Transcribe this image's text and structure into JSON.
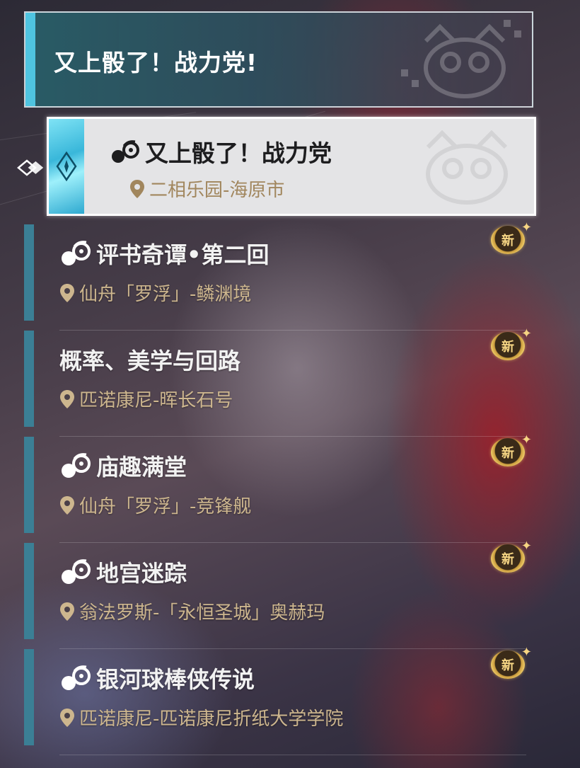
{
  "header": {
    "title": "又上骰了！战力党!"
  },
  "selected": {
    "title": "又上骰了！战力党",
    "location": "二相乐园-海原市",
    "icon": "dice-quest-icon"
  },
  "items": [
    {
      "title": "评书奇谭•第二回",
      "location": "仙舟「罗浮」-鳞渊境",
      "has_icon": true,
      "badge": "新"
    },
    {
      "title": "概率、美学与回路",
      "location": "匹诺康尼-晖长石号",
      "has_icon": false,
      "badge": "新"
    },
    {
      "title": "庙趣满堂",
      "location": "仙舟「罗浮」-竞锋舰",
      "has_icon": true,
      "badge": "新"
    },
    {
      "title": "地宫迷踪",
      "location": "翁法罗斯-「永恒圣城」奥赫玛",
      "has_icon": true,
      "badge": "新"
    },
    {
      "title": "银河球棒侠传说",
      "location": "匹诺康尼-匹诺康尼折纸大学学院",
      "has_icon": true,
      "badge": "新"
    }
  ],
  "colors": {
    "accent_cyan": "#4fc4e0",
    "list_bar": "#3b7f95",
    "location_gold": "#cdb68e",
    "badge_gold": "#f2cf6a"
  }
}
